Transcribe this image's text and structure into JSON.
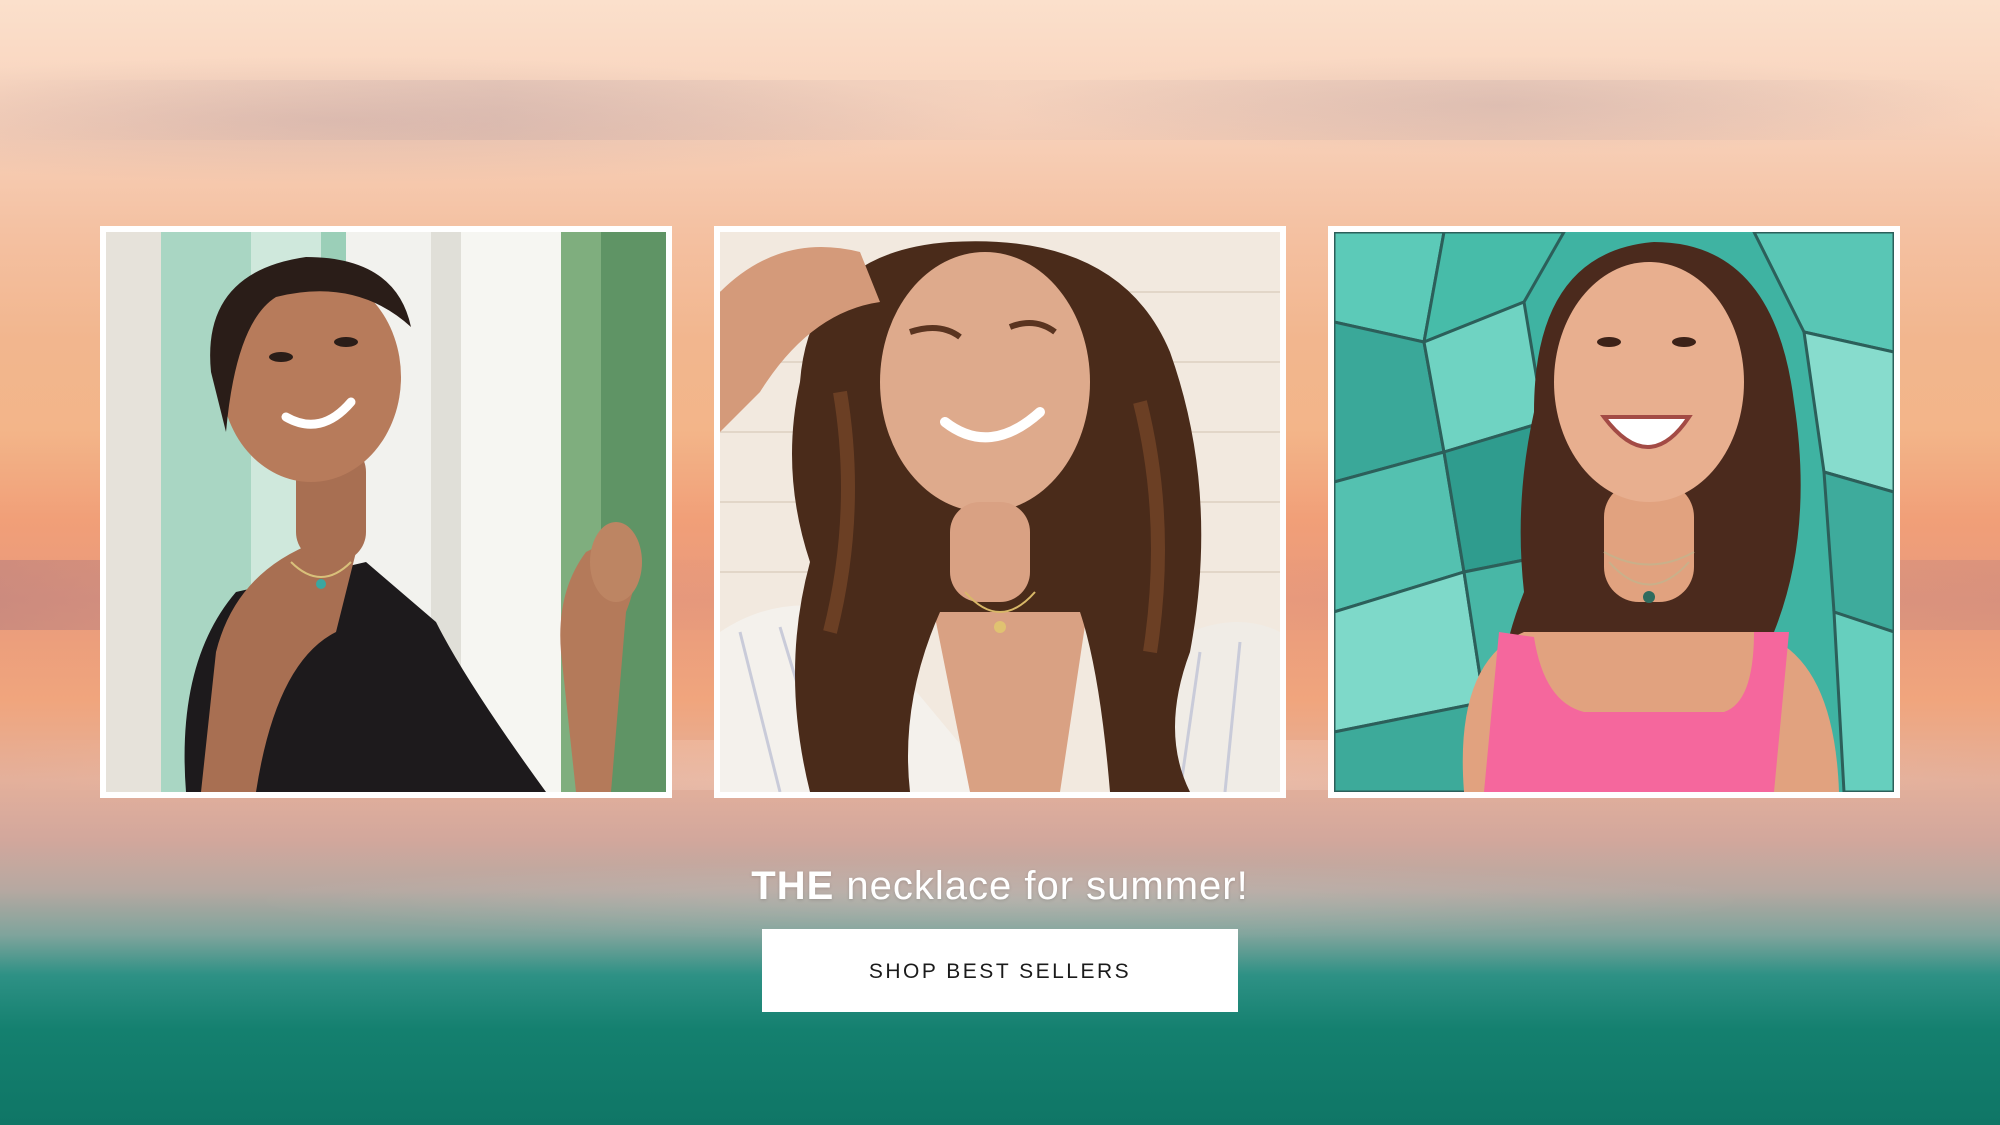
{
  "hero": {
    "tagline_strong": "THE",
    "tagline_rest": " necklace for summer!",
    "cta_label": "SHOP BEST SELLERS"
  },
  "photos": [
    {
      "subject": "woman-black-top-mint-door"
    },
    {
      "subject": "woman-curly-hair-striped-shirt"
    },
    {
      "subject": "woman-pink-top-teal-mosaic"
    }
  ],
  "colors": {
    "sky_top": "#fbe0cc",
    "sunset_orange": "#f19f78",
    "ocean_teal": "#14806f",
    "button_bg": "#ffffff",
    "button_text": "#1b1b1b"
  }
}
